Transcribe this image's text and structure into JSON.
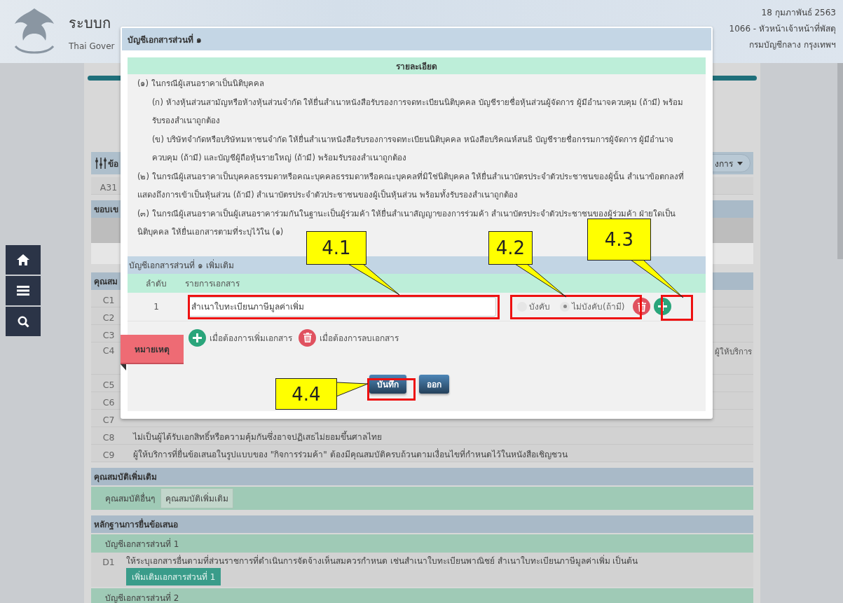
{
  "header": {
    "system_title": "ระบบก",
    "system_subtitle": "Thai Gover",
    "date": "18 กุมภาพันธ์ 2563",
    "user": "1066 - หัวหน้าเจ้าหน้าที่พัสดุ",
    "department": "กรมบัญชีกลาง กรุงเทพฯ"
  },
  "side_nav": [
    {
      "kind": "home"
    },
    {
      "kind": "menu"
    },
    {
      "kind": "search"
    }
  ],
  "panel": {
    "title": "ข้อ",
    "actions_button": "งการ",
    "rows": [
      {
        "kind": "code",
        "code": "A31"
      },
      {
        "kind": "section",
        "title": "ขอบเข"
      },
      {
        "kind": "blank_gray"
      },
      {
        "kind": "blank"
      },
      {
        "kind": "section",
        "title": "คุณสม"
      },
      {
        "kind": "code",
        "code": "C1"
      },
      {
        "kind": "code",
        "code": "C2"
      },
      {
        "kind": "code",
        "code": "C3"
      },
      {
        "kind": "code_tall",
        "code": "C4",
        "text_end": "ผู้ให้บริการ"
      },
      {
        "kind": "code",
        "code": "C5"
      },
      {
        "kind": "code",
        "code": "C6"
      },
      {
        "kind": "code",
        "code": "C7"
      },
      {
        "kind": "code",
        "code": "C8",
        "text": "ไม่เป็นผู้ได้รับเอกสิทธิ์หรือความคุ้มกันซึ่งอาจปฏิเสธไม่ยอมขึ้นศาลไทย"
      },
      {
        "kind": "code",
        "code": "C9",
        "text": "ผู้ให้บริการที่ยื่นข้อเสนอในรูปแบบของ \"กิจการร่วมค้า\" ต้องมีคุณสมบัติครบถ้วนตามเงื่อนไขที่กำหนดไว้ในหนังสือเชิญชวน"
      },
      {
        "kind": "section",
        "title": "คุณสมบัติเพิ่มเติม"
      },
      {
        "kind": "option",
        "label": "คุณสมบัติอื่นๆ",
        "button": "คุณสมบัติเพิ่มเติม"
      },
      {
        "kind": "section",
        "title": "หลักฐานการยื่นข้อเสนอ"
      },
      {
        "kind": "group",
        "title": "บัญชีเอกสารส่วนที่ 1"
      },
      {
        "kind": "doc",
        "code": "D1",
        "text": "ให้ระบุเอกสารอื่นตามที่ส่วนราชการที่ดำเนินการจัดจ้างเห็นสมควรกำหนด เช่นสำเนาใบทะเบียนพาณิชย์ สำเนาใบทะเบียนภาษีมูลค่าเพิ่ม เป็นต้น",
        "button": "เพิ่มเติมเอกสารส่วนที่ 1"
      },
      {
        "kind": "group",
        "title": "บัญชีเอกสารส่วนที่ 2"
      }
    ]
  },
  "modal": {
    "title": "บัญชีเอกสารส่วนที่ ๑",
    "details_heading": "รายละเอียด",
    "details": [
      {
        "text": "(๑) ในกรณีผู้เสนอราคาเป็นนิติบุคคล",
        "children": [
          {
            "text": "(ก) ห้างหุ้นส่วนสามัญหรือห้างหุ้นส่วนจำกัด ให้ยื่นสำเนาหนังสือรับรองการจดทะเบียนนิติบุคคล บัญชีรายชื่อหุ้นส่วนผู้จัดการ ผู้มีอำนาจควบคุม (ถ้ามี) พร้อมรับรองสำเนาถูกต้อง"
          },
          {
            "text": "(ข) บริษัทจำกัดหรือบริษัทมหาชนจำกัด ให้ยื่นสำเนาหนังสือรับรองการจดทะเบียนนิติบุคคล หนังสือบริคณห์สนธิ บัญชีรายชื่อกรรมการผู้จัดการ ผู้มีอำนาจควบคุม (ถ้ามี) และบัญชีผู้ถือหุ้นรายใหญ่ (ถ้ามี) พร้อมรับรองสำเนาถูกต้อง"
          }
        ]
      },
      {
        "text": "(๒) ในกรณีผู้เสนอราคาเป็นบุคคลธรรมดาหรือคณะบุคคลธรรมดาหรือคณะบุคคลที่มิใช่นิติบุคคล ให้ยื่นสำเนาบัตรประจำตัวประชาชนของผู้นั้น สำเนาข้อตกลงที่แสดงถึงการเข้าเป็นหุ้นส่วน (ถ้ามี) สำเนาบัตรประจำตัวประชาชนของผู้เป็นหุ้นส่วน พร้อมทั้งรับรองสำเนาถูกต้อง"
      },
      {
        "lines": [
          "(๓) ในกรณีผู้เสนอราคาเป็นผู้เสนอราคาร่วมกันในฐานะเป็นผู้ร่วมค้า ให้ยื่นสำเนาสัญญาของการร่วมค้า สำเนาบัตรประจำตัวประชาชนของผู้ร่วมค้า ฝ่ายใดเป็น",
          "นิติบุคคล ให้ยื่นเอกสารตามที่ระบุไว้ใน (๑)"
        ]
      }
    ],
    "extra": {
      "title": "บัญชีเอกสารส่วนที่ ๑ เพิ่มเติม",
      "columns": [
        "ลำดับ",
        "รายการเอกสาร"
      ],
      "rows": [
        {
          "index": "1",
          "document": "สำเนาใบทะเบียนภาษีมูลค่าเพิ่ม",
          "options": [
            {
              "label": "บังคับ",
              "selected": false
            },
            {
              "label": "ไม่บังคับ(ถ้ามี)",
              "selected": true
            }
          ]
        }
      ]
    },
    "legend": [
      {
        "kind": "add",
        "text": "เมื่อต้องการเพิ่มเอกสาร"
      },
      {
        "kind": "delete",
        "text": "เมื่อต้องการลบเอกสาร"
      }
    ],
    "note_tab": "หมายเหตุ",
    "buttons": [
      "บันทึก",
      "ออก"
    ]
  },
  "annotations": [
    {
      "label": "4.1"
    },
    {
      "label": "4.2"
    },
    {
      "label": "4.3"
    },
    {
      "label": "4.4"
    }
  ]
}
